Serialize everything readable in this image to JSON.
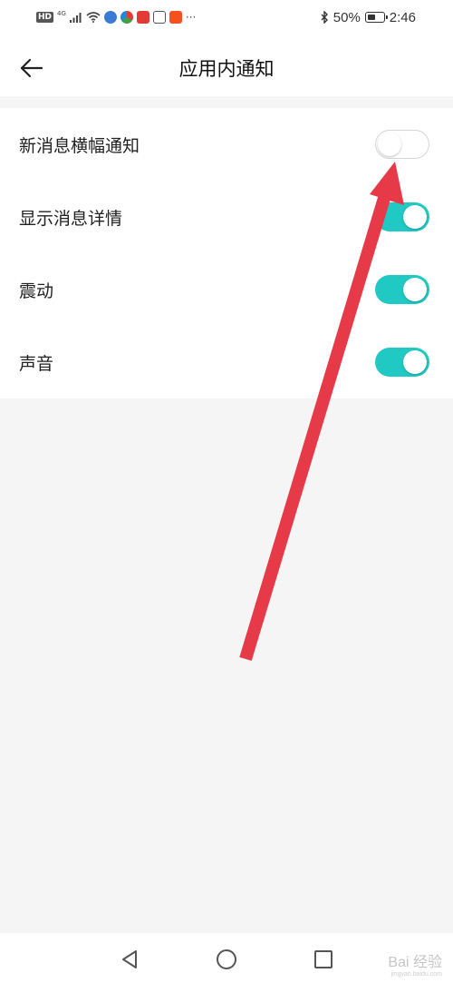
{
  "status_bar": {
    "hd_badge": "HD",
    "network_badge": "4G",
    "more_indicator": "···",
    "battery_percent": "50%",
    "battery_level": 0.5,
    "time": "2:46",
    "icons": [
      "signal-icon",
      "wifi-icon",
      "app-notification-icons",
      "bluetooth-icon",
      "battery-icon"
    ]
  },
  "header": {
    "title": "应用内通知",
    "back_icon": "back-arrow-icon"
  },
  "settings": [
    {
      "label": "新消息横幅通知",
      "enabled": false
    },
    {
      "label": "显示消息详情",
      "enabled": true
    },
    {
      "label": "震动",
      "enabled": true
    },
    {
      "label": "声音",
      "enabled": true
    }
  ],
  "nav_bar": {
    "icons": [
      "back-triangle-icon",
      "home-circle-icon",
      "recents-square-icon"
    ]
  },
  "watermark": {
    "text": "Bai 经验",
    "sub": "jingyan.baidu.com"
  },
  "colors": {
    "toggle_on": "#20c9c3",
    "annotation_arrow": "#e63a48",
    "background": "#f5f5f5"
  }
}
